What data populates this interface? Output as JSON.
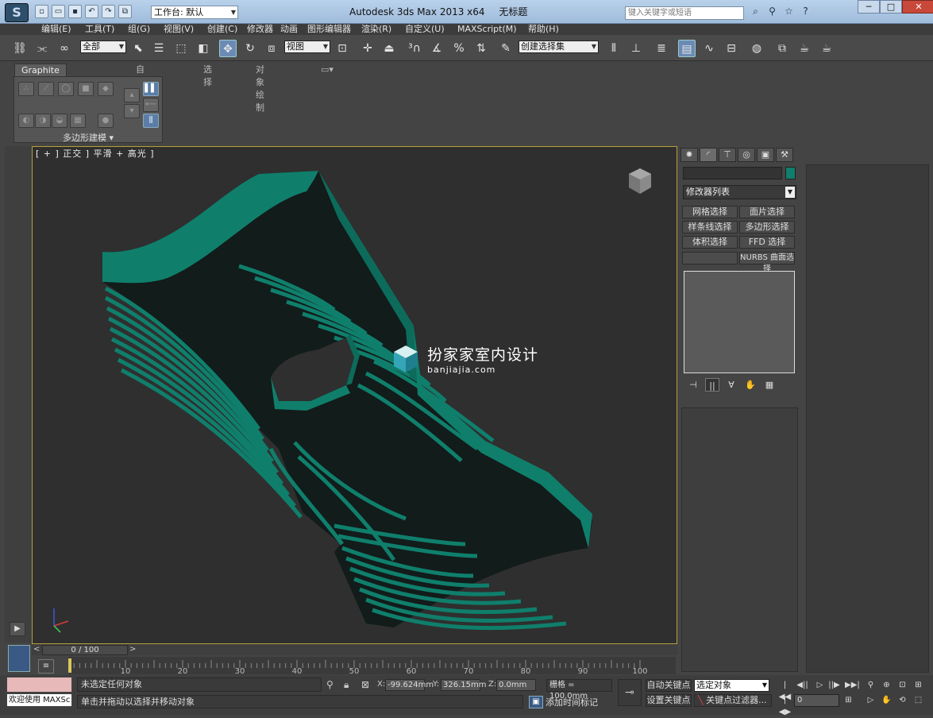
{
  "titlebar": {
    "workspace_label": "工作台: 默认",
    "app_name": "Autodesk 3ds Max  2013 x64",
    "doc_name": "无标题",
    "search_placeholder": "键入关键字或短语"
  },
  "menu": [
    "编辑(E)",
    "工具(T)",
    "组(G)",
    "视图(V)",
    "创建(C)",
    "修改器",
    "动画",
    "图形编辑器",
    "渲染(R)",
    "自定义(U)",
    "MAXScript(M)",
    "帮助(H)"
  ],
  "toolbar": {
    "filter_value": "全部",
    "refcoord_value": "视图",
    "named_selset_value": "创建选择集"
  },
  "ribbon": {
    "tabs": [
      "Graphite 建模工具",
      "自由形式",
      "选择",
      "对象绘制"
    ],
    "panel_label": "多边形建模 ▾"
  },
  "viewport": {
    "label": "[ + ] 正交 ] 平滑 + 高光 ]",
    "watermark_cn": "扮家家室内设计",
    "watermark_en": "banjiajia.com"
  },
  "command_panel": {
    "modifier_list": "修改器列表",
    "mod_buttons": [
      "网格选择",
      "面片选择",
      "样条线选择",
      "多边形选择",
      "体积选择",
      "FFD 选择",
      "",
      "NURBS 曲面选择"
    ],
    "object_color": "#0f7f6c"
  },
  "timeline": {
    "slider_text": "0 / 100",
    "ticks": [
      "10",
      "20",
      "30",
      "40",
      "50",
      "60",
      "70",
      "80",
      "90",
      "100"
    ]
  },
  "status": {
    "welcome": "欢迎使用 MAXSc",
    "line1": "未选定任何对象",
    "line2": "单击并拖动以选择并移动对象",
    "x_label": "X:",
    "x_value": "-99.624mm",
    "y_label": "Y:",
    "y_value": "326.15mm",
    "z_label": "Z:",
    "z_value": "0.0mm",
    "grid": "栅格 = 100.0mm",
    "add_time_tag": "添加时间标记",
    "auto_key": "自动关键点",
    "set_key": "设置关键点",
    "selection_dropdown": "选定对象",
    "key_filters": "关键点过滤器...",
    "frame": "0"
  }
}
